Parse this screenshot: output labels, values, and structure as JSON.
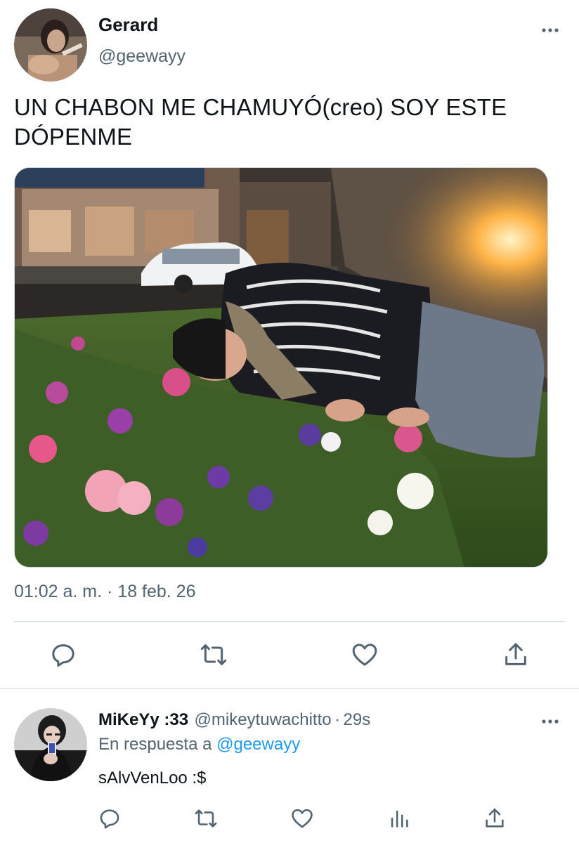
{
  "tweet": {
    "author_name": "Gerard",
    "author_handle": "@geewayy",
    "text_line1": "UN CHABON ME CHAMUYÓ(creo) SOY ESTE",
    "text_line2": "DÓPENME",
    "timestamp": "01:02 a. m. · 18 feb. 26",
    "more_icon": "more-horizontal-icon"
  },
  "actions": [
    "reply-icon",
    "retweet-icon",
    "like-icon",
    "share-icon"
  ],
  "reply": {
    "author_name": "MiKeYy :33",
    "author_handle": "@mikeytuwachitto",
    "time": "29s",
    "replying_prefix": "En respuesta a",
    "replying_to": "@geewayy",
    "text": "sAlvVenLoo :$",
    "actions": [
      "reply-icon",
      "retweet-icon",
      "like-icon",
      "analytics-icon",
      "share-icon"
    ]
  },
  "colors": {
    "text": "#0f1419",
    "secondary": "#536471",
    "link": "#1d9bf0",
    "divider": "#d6dde2"
  }
}
